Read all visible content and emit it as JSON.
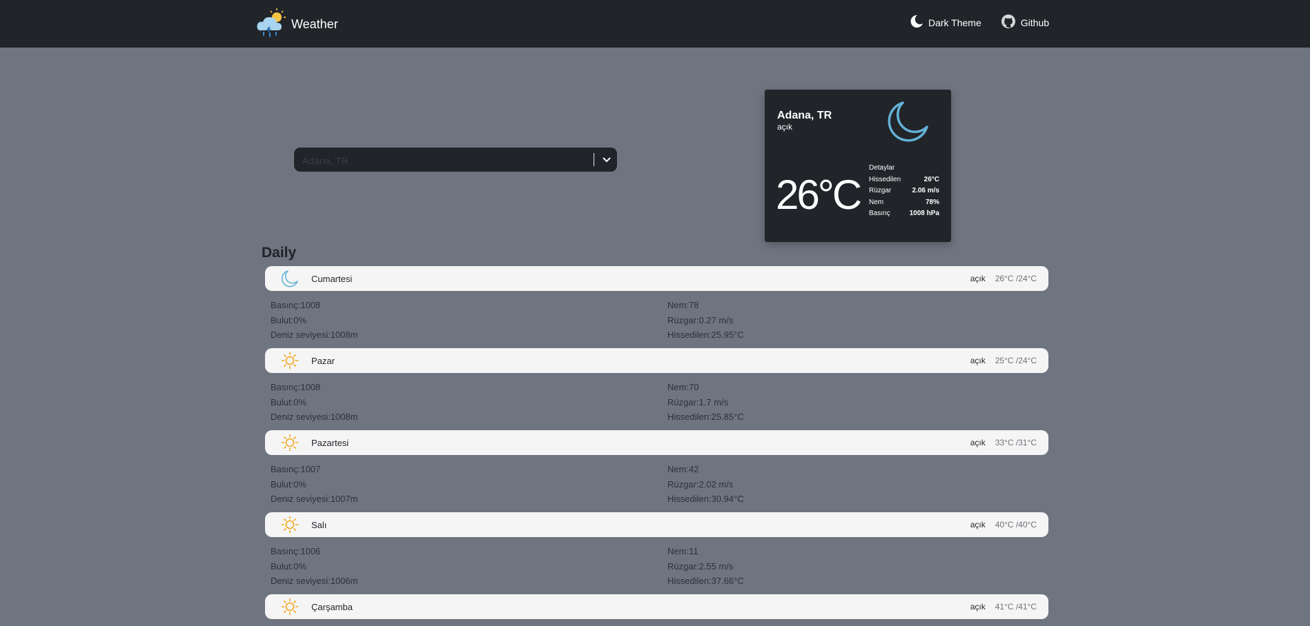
{
  "navbar": {
    "brand": "Weather",
    "dark_theme": "Dark Theme",
    "github": "Github"
  },
  "search": {
    "placeholder": "Adana, TR"
  },
  "current": {
    "city": "Adana, TR",
    "description": "açık",
    "temperature": "26°C",
    "details_title": "Detaylar",
    "details": [
      {
        "label": "Hissedilen",
        "value": "26°C"
      },
      {
        "label": "Rüzgar",
        "value": "2.06 m/s"
      },
      {
        "label": "Nem",
        "value": "78%"
      },
      {
        "label": "Basınç",
        "value": "1008 hPa"
      }
    ],
    "icon": "moon-icon"
  },
  "daily": {
    "title": "Daily",
    "days": [
      {
        "name": "Cumartesi",
        "icon": "moon-icon",
        "desc": "açık",
        "temp": "26°C /24°C",
        "pressure": "Basınç:1008",
        "cloud": "Bulut:0%",
        "sea": "Deniz seviyesi:1008m",
        "humidity": "Nem:78",
        "wind": "Rüzgar:0.27 m/s",
        "feels": "Hissedilen:25.95°C"
      },
      {
        "name": "Pazar",
        "icon": "sun-icon",
        "desc": "açık",
        "temp": "25°C /24°C",
        "pressure": "Basınç:1008",
        "cloud": "Bulut:0%",
        "sea": "Deniz seviyesi:1008m",
        "humidity": "Nem:70",
        "wind": "Rüzgar:1.7 m/s",
        "feels": "Hissedilen:25.85°C"
      },
      {
        "name": "Pazartesi",
        "icon": "sun-icon",
        "desc": "açık",
        "temp": "33°C /31°C",
        "pressure": "Basınç:1007",
        "cloud": "Bulut:0%",
        "sea": "Deniz seviyesi:1007m",
        "humidity": "Nem:42",
        "wind": "Rüzgar:2.02 m/s",
        "feels": "Hissedilen:30.94°C"
      },
      {
        "name": "Salı",
        "icon": "sun-icon",
        "desc": "açık",
        "temp": "40°C /40°C",
        "pressure": "Basınç:1006",
        "cloud": "Bulut:0%",
        "sea": "Deniz seviyesi:1006m",
        "humidity": "Nem:11",
        "wind": "Rüzgar:2.55 m/s",
        "feels": "Hissedilen:37.66°C"
      },
      {
        "name": "Çarşamba",
        "icon": "sun-icon",
        "desc": "açık",
        "temp": "41°C /41°C"
      }
    ]
  },
  "colors": {
    "background": "#6e7580",
    "navbar": "#212429",
    "moon": "#62b2d6",
    "sun": "#f3a71c"
  }
}
